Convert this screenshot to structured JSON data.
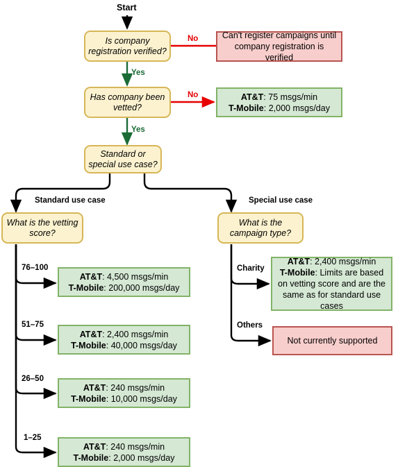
{
  "diagram": {
    "title": "Start",
    "nodes": {
      "start_label": "Start",
      "q_registration": "Is company registration verified?",
      "q_vetted": "Has company been vetted?",
      "q_usecase": "Standard or special use case?",
      "q_vetting_score": "What is the vetting score?",
      "q_campaign_type": "What is the campaign type?",
      "r_not_verified": "Can't register campaigns until company registration is verified",
      "r_not_vetted": {
        "line1_label": "AT&T",
        "line1_value": ": 75 msgs/min",
        "line2_label": "T-Mobile",
        "line2_value": ": 2,000 msgs/day"
      },
      "r_score_76_100": {
        "line1_label": "AT&T",
        "line1_value": ": 4,500 msgs/min",
        "line2_label": "T-Mobile",
        "line2_value": ": 200,000 msgs/day"
      },
      "r_score_51_75": {
        "line1_label": "AT&T",
        "line1_value": ": 2,400 msgs/min",
        "line2_label": "T-Mobile",
        "line2_value": ": 40,000 msgs/day"
      },
      "r_score_26_50": {
        "line1_label": "AT&T",
        "line1_value": ": 240 msgs/min",
        "line2_label": "T-Mobile",
        "line2_value": ": 10,000 msgs/day"
      },
      "r_score_1_25": {
        "line1_label": "AT&T",
        "line1_value": ": 240 msgs/min",
        "line2_label": "T-Mobile",
        "line2_value": ": 2,000 msgs/day"
      },
      "r_charity": {
        "line1_label": "AT&T",
        "line1_value": ": 2,400 msgs/min",
        "line2_label": "T-Mobile",
        "line2_value": ": Limits are based on vetting score and are the same as for standard use cases"
      },
      "r_others": "Not currently supported"
    },
    "edge_labels": {
      "yes_1": "Yes",
      "no_1": "No",
      "yes_2": "Yes",
      "no_2": "No",
      "standard_use_case": "Standard use case",
      "special_use_case": "Special use case",
      "score_76_100": "76–100",
      "score_51_75": "51–75",
      "score_26_50": "26–50",
      "score_1_25": "1–25",
      "charity": "Charity",
      "others": "Others"
    },
    "colors": {
      "decision_fill": "#fcf2cf",
      "decision_border": "#d6b656",
      "green_fill": "#d5e8d4",
      "green_border": "#82b366",
      "red_fill": "#f8cecc",
      "red_border": "#b85450",
      "yes_arrow": "#1a6b36",
      "no_arrow": "#e60000",
      "default_arrow": "#000000"
    }
  }
}
